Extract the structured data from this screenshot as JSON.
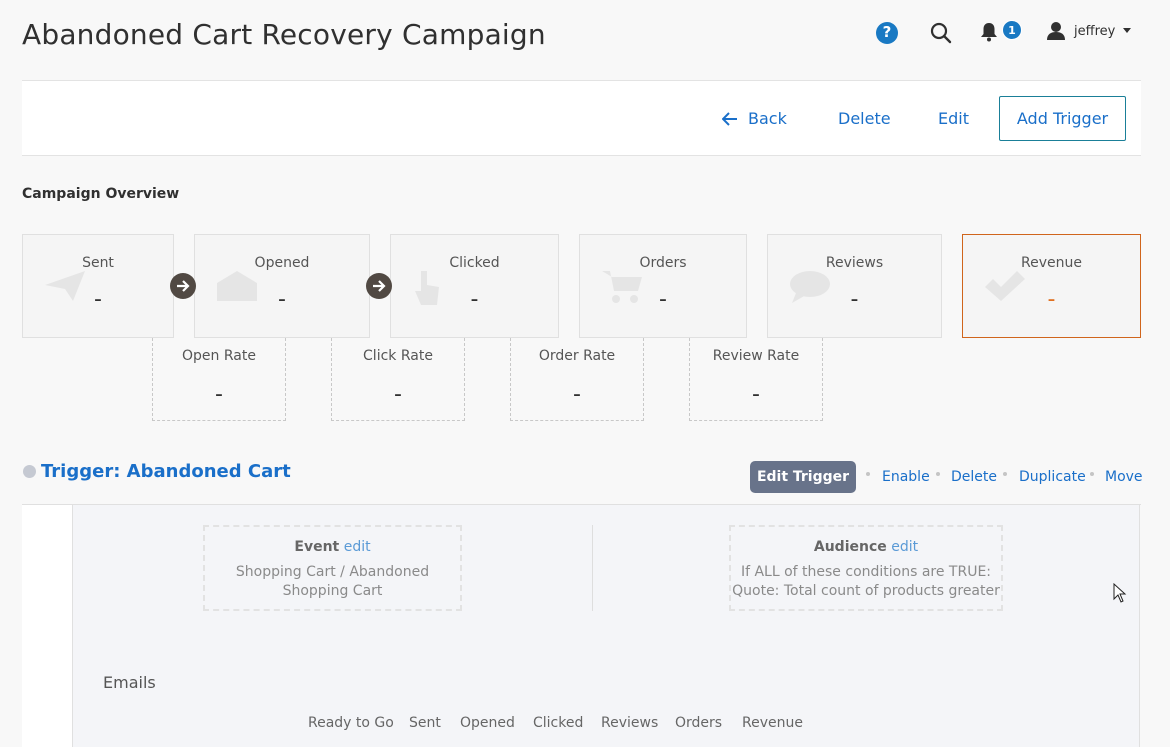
{
  "header": {
    "title": "Abandoned Cart Recovery Campaign",
    "help_icon": "question-circle-icon",
    "search_icon": "search-icon",
    "bell_icon": "bell-icon",
    "notification_count": "1",
    "user_name": "jeffrey"
  },
  "actions": {
    "back": "Back",
    "delete": "Delete",
    "edit": "Edit",
    "add_trigger": "Add Trigger"
  },
  "overview": {
    "title": "Campaign Overview",
    "stats": {
      "sent": {
        "label": "Sent",
        "value": "-"
      },
      "opened": {
        "label": "Opened",
        "value": "-"
      },
      "clicked": {
        "label": "Clicked",
        "value": "-"
      },
      "orders": {
        "label": "Orders",
        "value": "-"
      },
      "reviews": {
        "label": "Reviews",
        "value": "-"
      },
      "revenue": {
        "label": "Revenue",
        "value": "-"
      }
    },
    "rates": {
      "open": {
        "label": "Open Rate",
        "value": "-"
      },
      "click": {
        "label": "Click Rate",
        "value": "-"
      },
      "order": {
        "label": "Order Rate",
        "value": "-"
      },
      "review": {
        "label": "Review Rate",
        "value": "-"
      }
    }
  },
  "trigger": {
    "title": "Trigger: Abandoned Cart",
    "edit_button": "Edit Trigger",
    "links": {
      "enable": "Enable",
      "delete": "Delete",
      "duplicate": "Duplicate",
      "move": "Move"
    },
    "event": {
      "heading": "Event",
      "edit": "edit",
      "line1": "Shopping Cart / Abandoned",
      "line2": "Shopping Cart"
    },
    "audience": {
      "heading": "Audience",
      "edit": "edit",
      "line1": "If ALL of these conditions are TRUE:",
      "line2": "Quote: Total count of products greater"
    }
  },
  "emails": {
    "title": "Emails",
    "columns": [
      "Ready to Go",
      "Sent",
      "Opened",
      "Clicked",
      "Reviews",
      "Orders",
      "Revenue"
    ]
  },
  "colors": {
    "link": "#1a6fc9",
    "revenue_accent": "#d0651c",
    "badge": "#1979c3",
    "edit_trigger_bg": "#68738a"
  }
}
